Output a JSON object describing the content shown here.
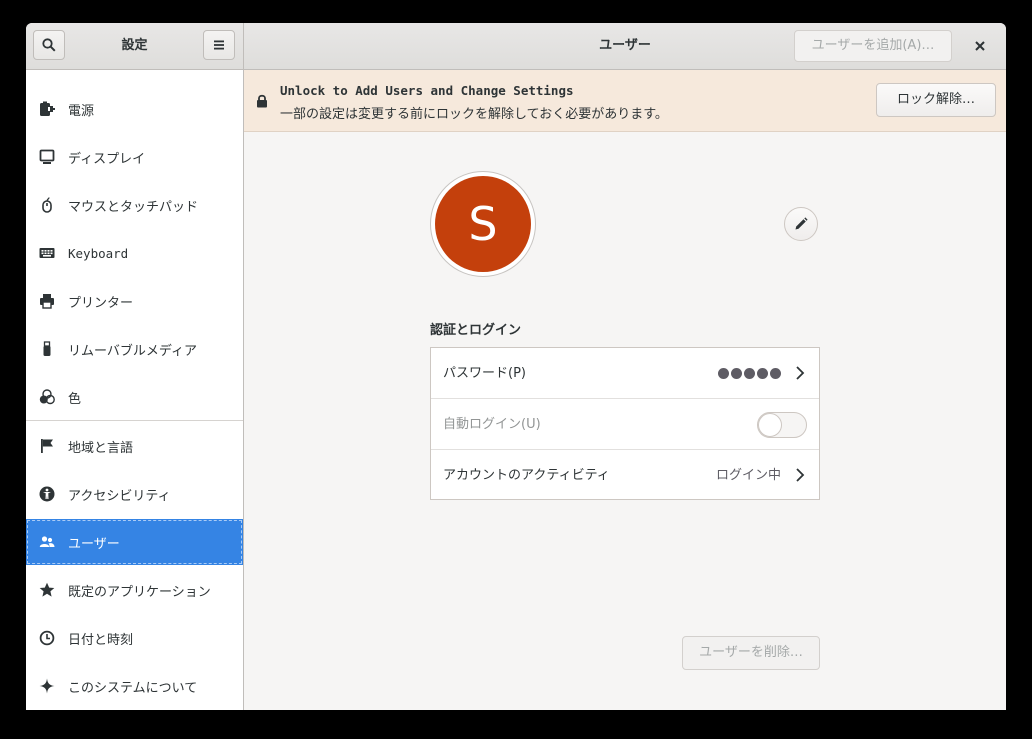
{
  "sidebar_header": {
    "title": "設定"
  },
  "header": {
    "title": "ユーザー",
    "add_user_label": "ユーザーを追加(A)…"
  },
  "sidebar": {
    "items": [
      {
        "label": "電源",
        "icon": "power-icon"
      },
      {
        "label": "ディスプレイ",
        "icon": "display-icon"
      },
      {
        "label": "マウスとタッチパッド",
        "icon": "mouse-icon"
      },
      {
        "label": "Keyboard",
        "icon": "keyboard-icon"
      },
      {
        "label": "プリンター",
        "icon": "printer-icon"
      },
      {
        "label": "リムーバブルメディア",
        "icon": "usb-icon"
      },
      {
        "label": "色",
        "icon": "color-icon"
      },
      {
        "label": "地域と言語",
        "icon": "flag-icon"
      },
      {
        "label": "アクセシビリティ",
        "icon": "accessibility-icon"
      },
      {
        "label": "ユーザー",
        "icon": "users-icon",
        "selected": true
      },
      {
        "label": "既定のアプリケーション",
        "icon": "star-icon"
      },
      {
        "label": "日付と時刻",
        "icon": "clock-icon"
      },
      {
        "label": "このシステムについて",
        "icon": "sparkle-icon"
      }
    ]
  },
  "banner": {
    "title": "Unlock to Add Users and Change Settings",
    "subtitle": "一部の設定は変更する前にロックを解除しておく必要があります。",
    "unlock_label": "ロック解除…"
  },
  "user": {
    "avatar_letter": "S",
    "avatar_color": "#c4400c"
  },
  "auth": {
    "section_title": "認証とログイン",
    "password_label": "パスワード(P)",
    "password_dots": 5,
    "autologin_label": "自動ログイン(U)",
    "autologin_enabled": false,
    "activity_label": "アカウントのアクティビティ",
    "activity_value": "ログイン中"
  },
  "delete_label": "ユーザーを削除…",
  "colors": {
    "accent": "#3584e4",
    "banner_bg": "#f6e9dc"
  }
}
